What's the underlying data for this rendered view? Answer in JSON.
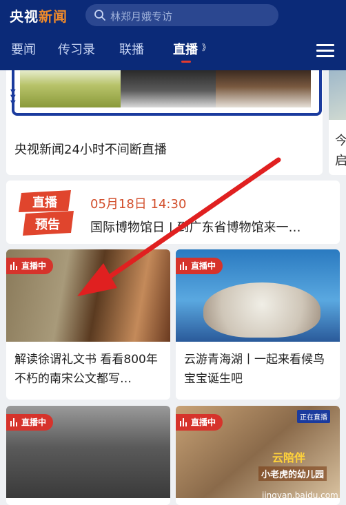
{
  "header": {
    "logo_main": "央视",
    "logo_accent": "新闻",
    "search_placeholder": "林郑月娥专访",
    "tabs": [
      {
        "label": "要闻",
        "active": false
      },
      {
        "label": "传习录",
        "active": false
      },
      {
        "label": "联播",
        "active": false
      },
      {
        "label": "直播",
        "active": true
      }
    ],
    "live_indicator": "》"
  },
  "top_card": {
    "title": "央视新闻24小时不间断直播"
  },
  "right_card": {
    "title_line1": "今",
    "title_line2": "启"
  },
  "preview": {
    "badge_top": "直播",
    "badge_bottom": "预告",
    "time": "05月18日 14:30",
    "title": "国际博物馆日 | 到广东省博物馆来一…"
  },
  "grid": [
    {
      "badge": "直播中",
      "title": "解读徐谓礼文书 看看800年不朽的南宋公文都写…"
    },
    {
      "badge": "直播中",
      "title": "云游青海湖丨一起来看候鸟宝宝诞生吧"
    },
    {
      "badge": "直播中",
      "title": ""
    },
    {
      "badge": "直播中",
      "title": "",
      "overlay_title": "云陪伴",
      "overlay_sub": "小老虎的幼儿园",
      "tag": "正在直播"
    }
  ],
  "watermark": "jingyan.baidu.com",
  "colors": {
    "header_bg": "#0b2a78",
    "accent_orange": "#f08a2a",
    "live_red": "#d6332b",
    "arrow_red": "#e02020"
  }
}
